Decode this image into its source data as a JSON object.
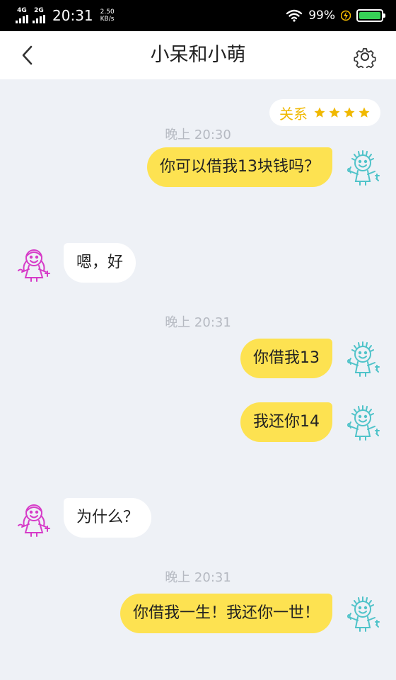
{
  "status_bar": {
    "signal1_label": "4G",
    "signal2_label": "2G",
    "time": "20:31",
    "net_speed_value": "2.50",
    "net_speed_unit": "KB/s",
    "battery_percent": "99%",
    "battery_level": 0.99
  },
  "header": {
    "title": "小呆和小萌"
  },
  "relation": {
    "label": "关系",
    "stars": 4
  },
  "messages": [
    {
      "timestamp": "晚上 20:30",
      "side": "out",
      "text": "你可以借我13块钱吗？"
    },
    {
      "side": "in",
      "text": "嗯，好"
    },
    {
      "timestamp": "晚上 20:31",
      "side": "out",
      "text": "你借我13"
    },
    {
      "side": "out",
      "text": "我还你14"
    },
    {
      "side": "in",
      "text": "为什么？"
    },
    {
      "timestamp": "晚上 20:31",
      "side": "out",
      "text": "你借我一生！我还你一世！"
    }
  ],
  "colors": {
    "bubble_out": "#fde251",
    "bubble_in": "#ffffff",
    "star": "#f0b800",
    "avatar_me": "#4fc3c9",
    "avatar_other": "#d63cc8",
    "background": "#eef1f6"
  },
  "icons": {
    "back": "chevron-left-icon",
    "settings": "gear-icon",
    "star": "star-icon",
    "avatar_me": "boy-doodle-avatar",
    "avatar_other": "girl-doodle-avatar"
  }
}
